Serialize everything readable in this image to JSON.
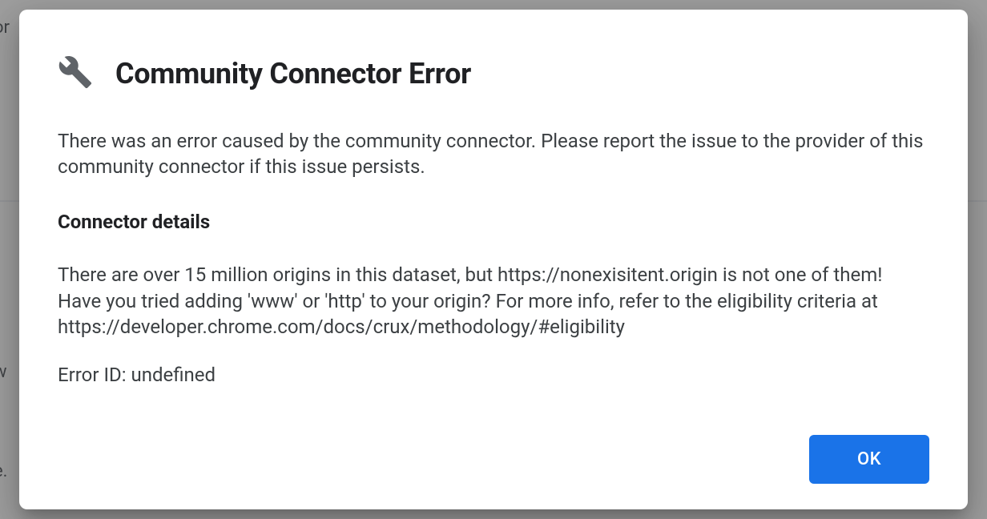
{
  "dialog": {
    "title": "Community Connector Error",
    "intro": "There was an error caused by the community connector. Please report the issue to the provider of this community connector if this issue persists.",
    "details_heading": "Connector details",
    "details_text": "There are over 15 million origins in this dataset, but https://nonexisitent.origin is not one of them! Have you tried adding 'www' or 'http' to your origin? For more info, refer to the eligibility criteria at https://developer.chrome.com/docs/crux/methodology/#eligibility",
    "error_id": "Error ID: undefined",
    "ok_label": "OK"
  },
  "background": {
    "frag1": "or",
    "frag2": "r",
    "frag3": "w",
    "frag4": "e."
  }
}
